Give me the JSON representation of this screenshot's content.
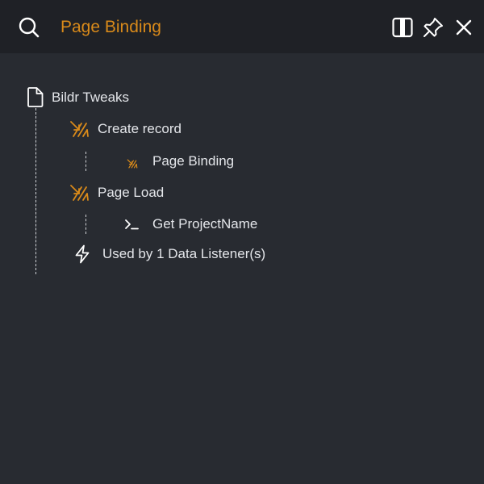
{
  "header": {
    "title": "Page Binding",
    "icons": {
      "search": "search-icon",
      "panel": "split-panel-icon",
      "pin": "pin-icon",
      "close": "close-icon"
    }
  },
  "tree": {
    "root": {
      "label": "Bildr Tweaks",
      "icon": "document-icon"
    },
    "actions": [
      {
        "label": "Create record",
        "icon": "action-flow-icon",
        "children": [
          {
            "label": "Page Binding",
            "icon": "action-flow-icon"
          }
        ]
      },
      {
        "label": "Page Load",
        "icon": "action-flow-icon",
        "children": [
          {
            "label": "Get ProjectName",
            "icon": "terminal-icon"
          }
        ]
      }
    ],
    "listener": {
      "label": "Used by 1 Data Listener(s)",
      "icon": "lightning-icon"
    }
  },
  "colors": {
    "background": "#282b31",
    "header_background": "#1f2126",
    "accent": "#d98a1a",
    "text": "#e4e6ea"
  }
}
